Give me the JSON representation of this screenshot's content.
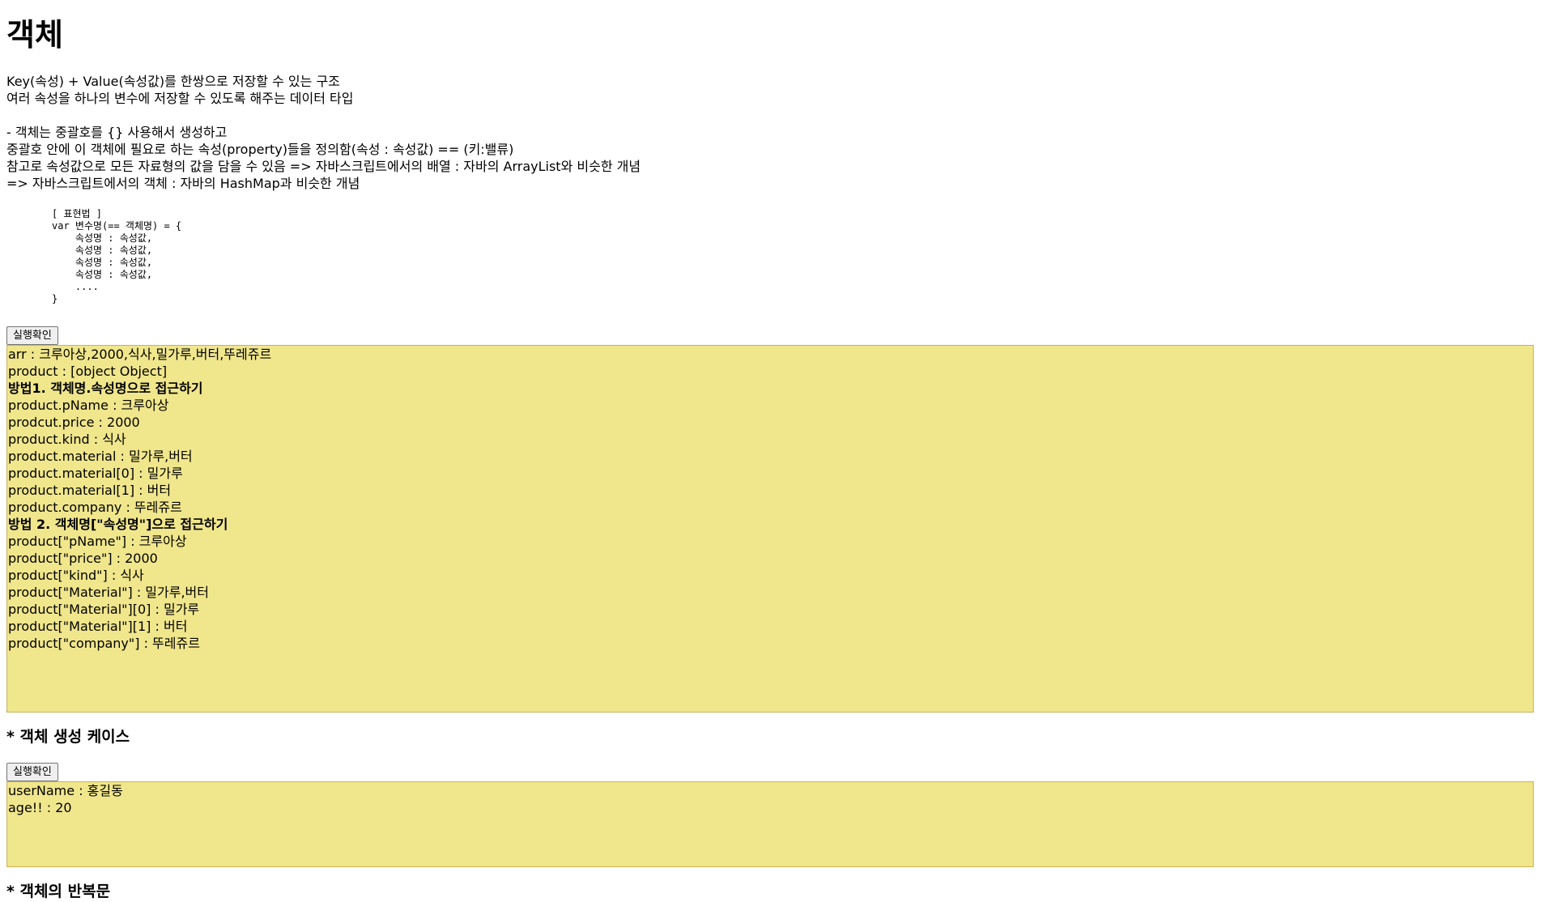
{
  "page": {
    "title": "객체",
    "intro": [
      "Key(속성) + Value(속성값)를 한쌍으로 저장할 수 있는 구조",
      "여러 속성을 하나의 변수에 저장할 수 있도록 해주는 데이터 타입",
      "",
      "- 객체는 중괄호를 {} 사용해서 생성하고",
      "중괄호 안에 이 객체에 필요로 하는 속성(property)들을 정의함(속성 : 속성값) == (키:밸류)",
      "참고로 속성값으로 모든 자료형의 값을 담을 수 있음 => 자바스크립트에서의 배열 : 자바의 ArrayList와 비슷한 개념",
      "=> 자바스크립트에서의 객체 : 자바의 HashMap과 비슷한 개념"
    ],
    "syntax_block": "[ 표현법 ]\nvar 변수명(== 객체명) = {\n    속성명 : 속성값,\n    속성명 : 속성값,\n    속성명 : 속성값,\n    속성명 : 속성값,\n    ....\n}"
  },
  "section1": {
    "button_label": "실행확인",
    "output_lines": [
      {
        "text": "arr : 크루아상,2000,식사,밀가루,버터,뚜레쥬르",
        "bold": false
      },
      {
        "text": "product : [object Object]",
        "bold": false
      },
      {
        "text": "방법1. 객체명.속성명으로 접근하기",
        "bold": true
      },
      {
        "text": "product.pName : 크루아상",
        "bold": false
      },
      {
        "text": "prodcut.price : 2000",
        "bold": false
      },
      {
        "text": "product.kind : 식사",
        "bold": false
      },
      {
        "text": "product.material : 밀가루,버터",
        "bold": false
      },
      {
        "text": "product.material[0] : 밀가루",
        "bold": false
      },
      {
        "text": "product.material[1] : 버터",
        "bold": false
      },
      {
        "text": "product.company : 뚜레쥬르",
        "bold": false
      },
      {
        "text": "방법 2. 객체명[\"속성명\"]으로 접근하기",
        "bold": true
      },
      {
        "text": "product[\"pName\"] : 크루아상",
        "bold": false
      },
      {
        "text": "product[\"price\"] : 2000",
        "bold": false
      },
      {
        "text": "product[\"kind\"] : 식사",
        "bold": false
      },
      {
        "text": "product[\"Material\"] : 밀가루,버터",
        "bold": false
      },
      {
        "text": "product[\"Material\"][0] : 밀가루",
        "bold": false
      },
      {
        "text": "product[\"Material\"][1] : 버터",
        "bold": false
      },
      {
        "text": "product[\"company\"] : 뚜레쥬르",
        "bold": false
      }
    ]
  },
  "section2": {
    "heading": "* 객체 생성 케이스",
    "button_label": "실행확인",
    "output_lines": [
      {
        "text": "userName : 홍길동",
        "bold": false
      },
      {
        "text": "age!! : 20",
        "bold": false
      }
    ]
  },
  "section3": {
    "heading": "* 객체의 반복문"
  },
  "colors": {
    "result_background": "#f0e68c",
    "result_border": "#c9b25a"
  }
}
